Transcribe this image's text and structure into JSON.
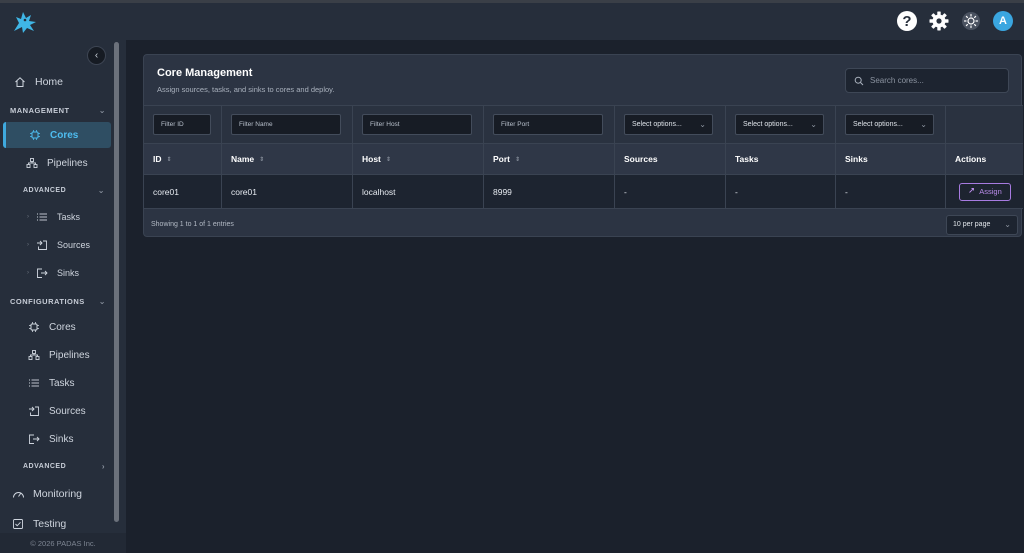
{
  "header": {
    "help_label": "?",
    "avatar_initial": "A"
  },
  "sidebar": {
    "home": "Home",
    "management": {
      "title": "MANAGEMENT",
      "items": [
        "Cores",
        "Pipelines"
      ],
      "advanced": {
        "title": "ADVANCED",
        "items": [
          "Tasks",
          "Sources",
          "Sinks"
        ]
      }
    },
    "configurations": {
      "title": "CONFIGURATIONS",
      "items": [
        "Cores",
        "Pipelines",
        "Tasks",
        "Sources",
        "Sinks"
      ],
      "advanced": {
        "title": "ADVANCED"
      }
    },
    "monitoring": "Monitoring",
    "testing": "Testing",
    "copyright": "© 2026 PADAS Inc."
  },
  "main": {
    "title": "Core Management",
    "subtitle": "Assign sources, tasks, and sinks to cores and deploy.",
    "search_placeholder": "Search cores...",
    "filters": {
      "id": "Filter ID",
      "name": "Filter Name",
      "host": "Filter Host",
      "port": "Filter Port",
      "sources": "Select options...",
      "tasks": "Select options...",
      "sinks": "Select options..."
    },
    "columns": [
      "ID",
      "Name",
      "Host",
      "Port",
      "Sources",
      "Tasks",
      "Sinks",
      "Actions"
    ],
    "rows": [
      {
        "id": "core01",
        "name": "core01",
        "host": "localhost",
        "port": "8999",
        "sources": "-",
        "tasks": "-",
        "sinks": "-",
        "action": "Assign"
      }
    ],
    "showing": "Showing 1 to 1 of 1 entries",
    "per_page": "10 per page"
  },
  "colors": {
    "accent": "#3fa9de",
    "assign": "#b98ce9",
    "background": "#1b212c",
    "panel": "#2c3443"
  }
}
